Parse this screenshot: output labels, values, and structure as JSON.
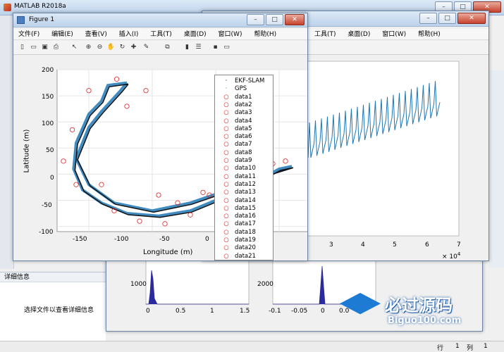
{
  "matlab": {
    "title": "MATLAB R2018a",
    "status_row": "行",
    "status_row_val": "1",
    "status_col": "列",
    "status_col_val": "1",
    "details_header": "详细信息",
    "details_text": "选择文件以查看详细信息"
  },
  "fig1": {
    "title": "Figure 1",
    "menu": [
      "文件(F)",
      "编辑(E)",
      "查看(V)",
      "插入(I)",
      "工具(T)",
      "桌面(D)",
      "窗口(W)",
      "帮助(H)"
    ],
    "xlabel": "Longitude (m)",
    "ylabel": "Latitude (m)",
    "xticks": [
      "-150",
      "-100",
      "-50",
      "0"
    ],
    "yticks": [
      "200",
      "150",
      "100",
      "50",
      "0",
      "-50",
      "-100"
    ],
    "legend": [
      "EKF-SLAM",
      "GPS",
      "data1",
      "data2",
      "data3",
      "data4",
      "data5",
      "data6",
      "data7",
      "data8",
      "data9",
      "data10",
      "data11",
      "data12",
      "data13",
      "data14",
      "data15",
      "data16",
      "data17",
      "data18",
      "data19",
      "data20",
      "data21"
    ]
  },
  "fig2": {
    "menu": [
      "工具(T)",
      "桌面(D)",
      "窗口(W)",
      "帮助(H)"
    ],
    "xticks": [
      "3",
      "4",
      "5",
      "6",
      "7"
    ],
    "xexp": "× 10",
    "xexp_pow": "4"
  },
  "fig3": {
    "left_ytick": "1000",
    "left_xticks": [
      "0",
      "0.5",
      "1",
      "1.5"
    ],
    "right_ytick": "2000",
    "right_xticks": [
      "-0.1",
      "-0.05",
      "0",
      "0.0"
    ]
  },
  "watermark": {
    "main": "必过源码",
    "sub": "Biguo100.com"
  },
  "colors": {
    "series_blue": "#1f77b4",
    "series_red": "#e02020",
    "title_bar": "#c9dbef",
    "hist": "#2b2b9e"
  }
}
